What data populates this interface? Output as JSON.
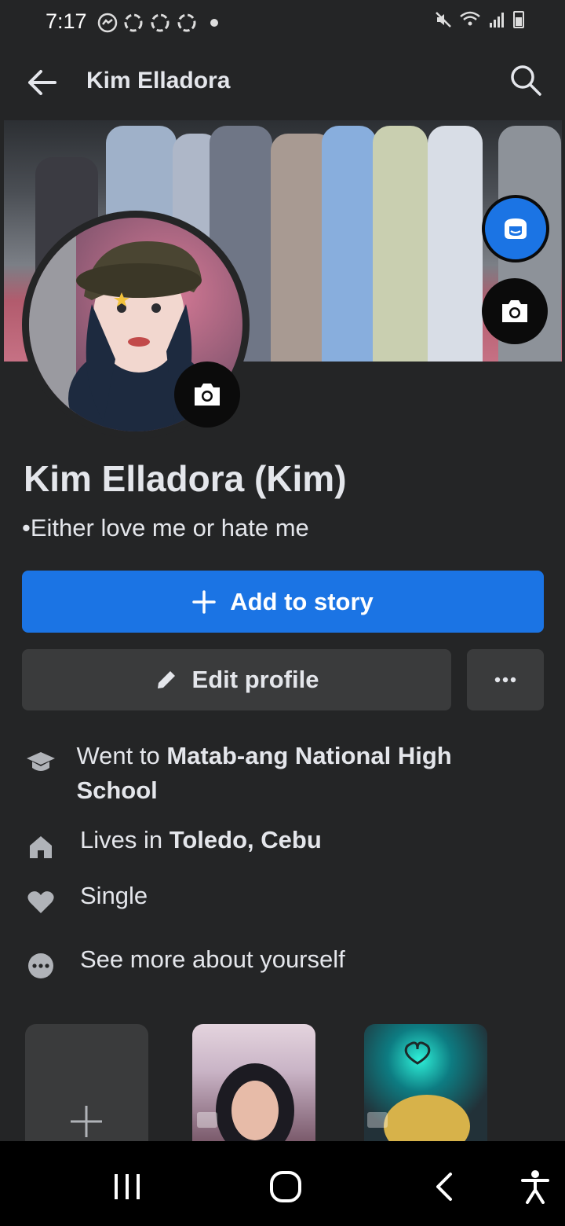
{
  "status_bar": {
    "time": "7:17"
  },
  "app_bar": {
    "title": "Kim Elladora"
  },
  "profile": {
    "name": "Kim Elladora (Kim)",
    "bio": "•Either love me or hate me"
  },
  "actions": {
    "add_story_label": "Add to story",
    "edit_profile_label": "Edit profile"
  },
  "details": {
    "education_prefix": "Went to ",
    "education_school": "Matab-ang National High School",
    "lives_prefix": "Lives in ",
    "lives_place": "Toledo, Cebu",
    "relationship": "Single",
    "see_more": "See more about yourself"
  },
  "colors": {
    "background": "#242526",
    "primary_button": "#1b74e4",
    "secondary_button": "#3a3b3c",
    "text": "#e4e6eb"
  },
  "icons": {
    "back": "arrow-left",
    "search": "magnifier",
    "camera": "camera",
    "avatar_button": "avatar-face",
    "add": "plus",
    "edit": "pencil",
    "more": "ellipsis",
    "education": "graduation-cap",
    "home": "house",
    "relationship": "heart",
    "see_more": "ellipsis-circle"
  }
}
